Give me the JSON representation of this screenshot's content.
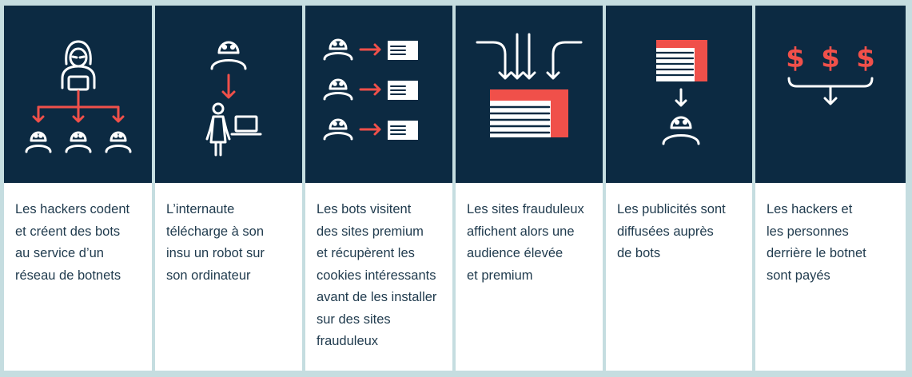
{
  "palette": {
    "navy": "#0c2a42",
    "red": "#f0504a",
    "white": "#ffffff",
    "text": "#1f3a4d",
    "frame": "#c5dde0"
  },
  "steps": [
    {
      "icon": "hacker-to-bots-icon",
      "lines": [
        "Les hackers codent",
        "et créent des bots",
        "au service d’un",
        "réseau de botnets"
      ]
    },
    {
      "icon": "user-downloads-robot-icon",
      "lines": [
        "L’internaute",
        "télécharge à son",
        "insu un robot sur",
        "son ordinateur"
      ]
    },
    {
      "icon": "bots-visit-sites-icon",
      "lines": [
        "Les bots visitent",
        "des sites premium",
        "et récupèrent les",
        "cookies intéressants",
        "avant de les installer",
        "sur des sites",
        "frauduleux"
      ]
    },
    {
      "icon": "sites-merge-icon",
      "lines": [
        "Les sites frauduleux",
        "affichent alors une",
        "audience élevée",
        "et premium"
      ]
    },
    {
      "icon": "ads-to-bot-icon",
      "lines": [
        "Les publicités sont",
        "diffusées auprès",
        "de bots"
      ]
    },
    {
      "icon": "dollars-paid-icon",
      "lines": [
        "Les hackers et",
        "les personnes",
        "derrière le botnet",
        "sont payés"
      ]
    }
  ]
}
